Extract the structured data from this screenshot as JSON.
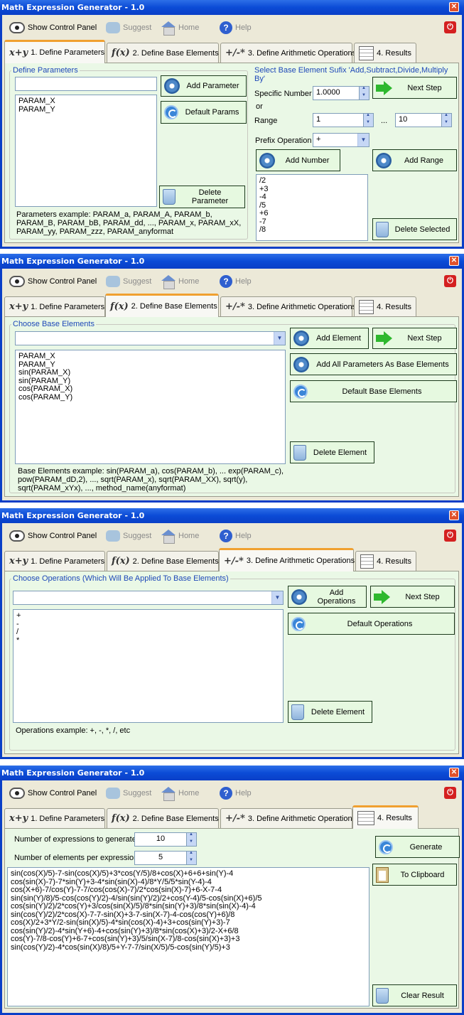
{
  "app": {
    "title": "Math Expression Generator - 1.0",
    "close": "✕",
    "power": "⏻"
  },
  "toolbar": {
    "show_control_panel": "Show Control Panel",
    "suggest": "Suggest",
    "home": "Home",
    "help": "Help"
  },
  "tabs": {
    "t1": "1. Define Parameters",
    "t2": "2. Define Base Elements",
    "t3": "3. Define Arithmetic Operations",
    "t4": "4. Results",
    "t1_icon": "x+y",
    "t2_icon": "f(x)",
    "t3_icon": "+/-*"
  },
  "params": {
    "legend": "Define Parameters",
    "input_value": "",
    "items": [
      "PARAM_X",
      "PARAM_Y"
    ],
    "add_button": "Add Parameter",
    "default_button": "Default Params",
    "delete_button": "Delete Parameter",
    "example": "Parameters example: PARAM_a, PARAM_A, PARAM_b, PARAM_B, PARAM_bB, PARAM_dd, ..., PARAM_x, PARAM_xX, PARAM_yy, PARAM_zzz, PARAM_anyformat",
    "suffix_legend": "Select Base Element Sufix 'Add,Subtract,Divide,Multiply By'",
    "specific_number_label": "Specific Number",
    "specific_number_value": "1.0000",
    "or_label": "or",
    "range_label": "Range",
    "range_from": "1",
    "range_dots": "...",
    "range_to": "10",
    "prefix_label": "Prefix Operation",
    "prefix_value": "+",
    "next_step": "Next Step",
    "add_number": "Add Number",
    "add_range": "Add Range",
    "delete_selected": "Delete Selected",
    "suffix_items": [
      "/2",
      "+3",
      "-4",
      "/5",
      "+6",
      "-7",
      "/8"
    ]
  },
  "base": {
    "legend": "Choose Base Elements",
    "combo_value": "",
    "items": [
      "PARAM_X",
      "PARAM_Y",
      "sin(PARAM_X)",
      "sin(PARAM_Y)",
      "cos(PARAM_X)",
      "cos(PARAM_Y)"
    ],
    "add_button": "Add Element",
    "next_step": "Next Step",
    "add_all_button": "Add All Parameters As Base Elements",
    "default_button": "Default Base Elements",
    "delete_button": "Delete Element",
    "example": "Base Elements example: sin(PARAM_a), cos(PARAM_b), ... exp(PARAM_c), pow(PARAM_dD,2), ..., sqrt(PARAM_x), sqrt(PARAM_XX), sqrt(y), sqrt(PARAM_xYx), ..., method_name(anyformat)"
  },
  "ops": {
    "legend": "Choose Operations (Which Will Be Applied To Base Elements)",
    "combo_value": "",
    "items": [
      "+",
      "-",
      "/",
      "*"
    ],
    "add_button": "Add Operations",
    "next_step": "Next Step",
    "default_button": "Default Operations",
    "delete_button": "Delete Element",
    "example": "Operations example: +, -, *, /, etc"
  },
  "results": {
    "num_expr_label": "Number of expressions to generate",
    "num_expr_value": "10",
    "num_elem_label": "Number of elements per expression",
    "num_elem_value": "5",
    "generate_button": "Generate",
    "clipboard_button": "To Clipboard",
    "clear_button": "Clear Result",
    "lines": [
      "sin(cos(X)/5)-7-sin(cos(X)/5)+3*cos(Y/5)/8+cos(X)+6+6+sin(Y)-4",
      "cos(sin(X)-7)-7*sin(Y)+3-4*sin(sin(X)-4)/8*Y/5/5*sin(Y-4)-4",
      "cos(X+6)-7/cos(Y)-7-7/cos(cos(X)-7)/2*cos(sin(X)-7)+6-X-7-4",
      "sin(sin(Y)/8)/5-cos(cos(Y)/2)-4/sin(sin(Y)/2)/2+cos(Y-4)/5-cos(sin(X)+6)/5",
      "cos(sin(Y)/2)/2*cos(Y)+3/cos(sin(X)/5)/8*sin(sin(Y)+3)/8*sin(sin(X)-4)-4",
      "sin(cos(Y)/2)/2*cos(X)-7-7-sin(X)+3-7-sin(X-7)-4-cos(cos(Y)+6)/8",
      "cos(X)/2+3*Y/2-sin(sin(X)/5)-4*sin(cos(X)-4)+3+cos(sin(Y)+3)-7",
      "cos(sin(Y)/2)-4*sin(Y+6)-4+cos(sin(Y)+3)/8*sin(cos(X)+3)/2-X+6/8",
      "cos(Y)-7/8-cos(Y)+6-7+cos(sin(Y)+3)/5/sin(X-7)/8-cos(sin(X)+3)+3",
      "sin(cos(Y)/2)-4*cos(sin(X)/8)/5+Y-7-7/sin(X/5)/5-cos(sin(Y)/5)+3"
    ]
  }
}
